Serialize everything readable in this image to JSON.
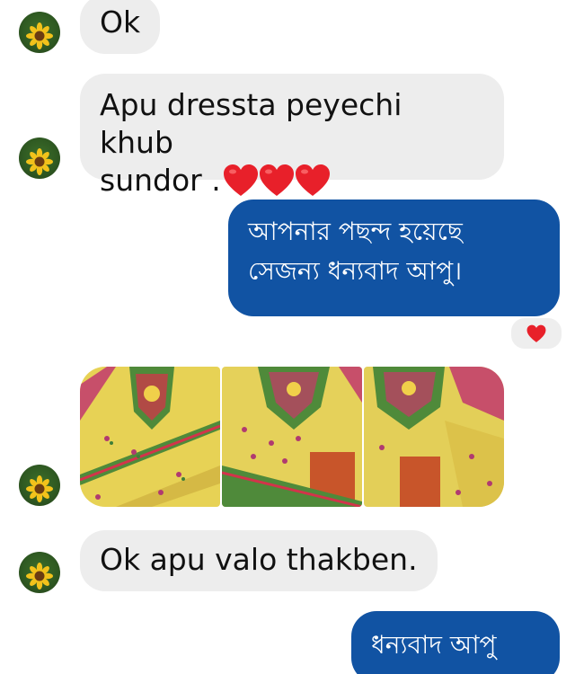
{
  "messages": [
    {
      "sender": "them",
      "text": "Ok"
    },
    {
      "sender": "them",
      "text_line1": "Apu dressta peyechi khub",
      "text_line2": "sundor ."
    },
    {
      "sender": "me",
      "text_line1": "আপনার পছন্দ হয়েছে",
      "text_line2": "সেজন্য ধন্যবাদ আপু।",
      "reaction": "heart"
    },
    {
      "sender": "them",
      "attachment": "3 photos of yellow embroidered dress fabric"
    },
    {
      "sender": "them",
      "text": "Ok apu valo thakben."
    },
    {
      "sender": "me",
      "text": "ধন্যবাদ আপু"
    }
  ],
  "avatar": {
    "icon": "sunflower-avatar-icon"
  },
  "colors": {
    "incoming_bubble": "#ededed",
    "outgoing_bubble": "#1153a3",
    "heart": "#e8202a"
  }
}
